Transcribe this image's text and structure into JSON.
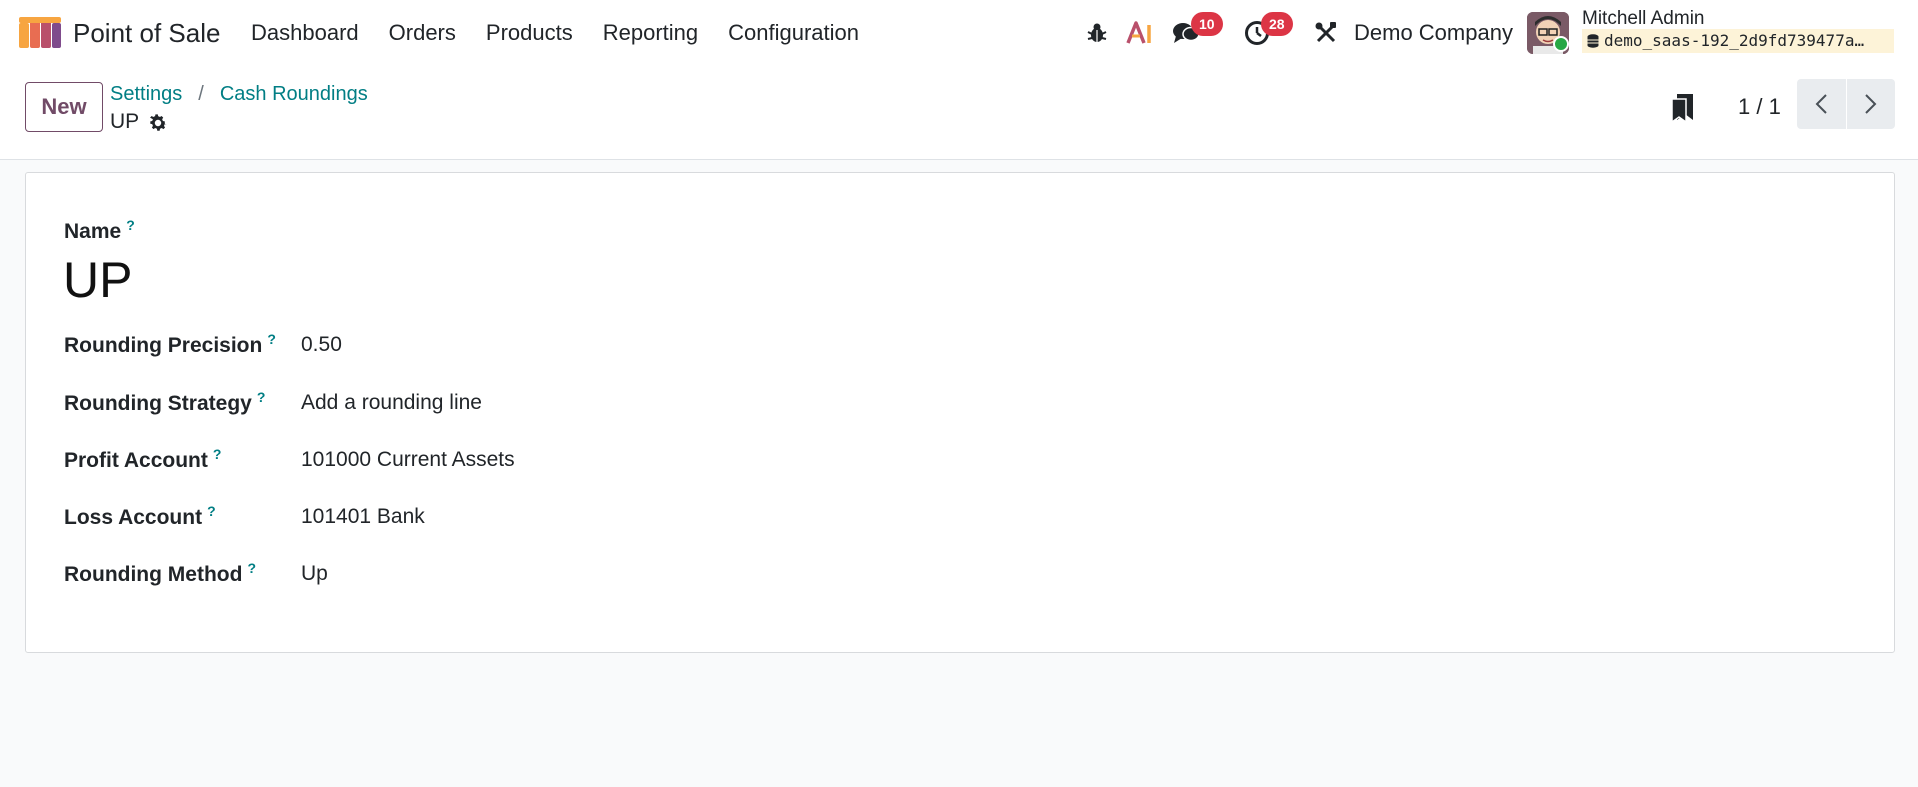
{
  "app": {
    "name": "Point of Sale",
    "menu": [
      "Dashboard",
      "Orders",
      "Products",
      "Reporting",
      "Configuration"
    ]
  },
  "systray": {
    "messages_count": "10",
    "activities_count": "28",
    "company": "Demo Company",
    "user_name": "Mitchell Admin",
    "database": "demo_saas-192_2d9fd739477a…"
  },
  "control_panel": {
    "new_label": "New",
    "breadcrumbs": [
      "Settings",
      "Cash Roundings"
    ],
    "breadcrumb_separator": "/",
    "record_name": "UP",
    "pager": "1 / 1"
  },
  "form": {
    "name_label": "Name",
    "name_value": "UP",
    "help_mark": "?",
    "fields": [
      {
        "label": "Rounding Precision",
        "value": "0.50"
      },
      {
        "label": "Rounding Strategy",
        "value": "Add a rounding line"
      },
      {
        "label": "Profit Account",
        "value": "101000 Current Assets"
      },
      {
        "label": "Loss Account",
        "value": "101401 Bank"
      },
      {
        "label": "Rounding Method",
        "value": "Up"
      }
    ]
  },
  "colors": {
    "brand": "#714b67",
    "link": "#017e84",
    "badge": "#dc3545",
    "presence": "#28a745",
    "db_chip": "#fdf3d8"
  },
  "icons": [
    "pos-logo-icon",
    "bug-icon",
    "ai-icon",
    "chat-icon",
    "clock-icon",
    "tools-icon",
    "database-icon",
    "gear-icon",
    "bookmark-icon",
    "chevron-left-icon",
    "chevron-right-icon"
  ]
}
